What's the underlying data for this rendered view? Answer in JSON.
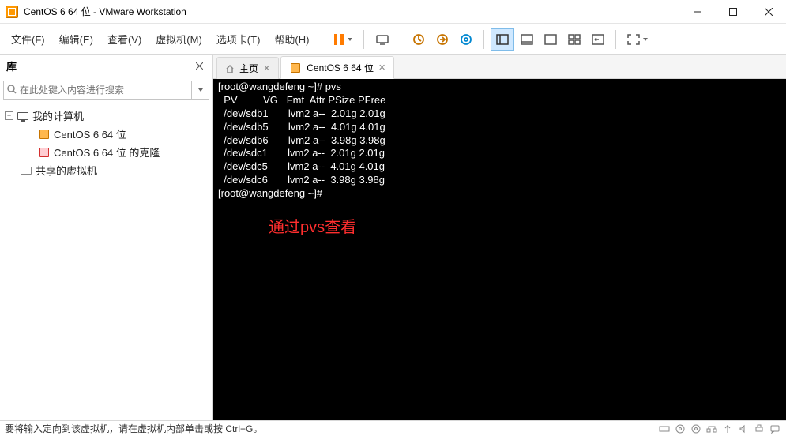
{
  "title": "CentOS 6 64 位 - VMware Workstation",
  "menu": {
    "file": "文件(F)",
    "edit": "编辑(E)",
    "view": "查看(V)",
    "vm": "虚拟机(M)",
    "tabs": "选项卡(T)",
    "help": "帮助(H)"
  },
  "sidebar": {
    "title": "库",
    "search_placeholder": "在此处键入内容进行搜索",
    "nodes": {
      "mycomputer": "我的计算机",
      "vm1": "CentOS 6 64 位",
      "vm2": "CentOS 6 64 位 的克隆",
      "shared": "共享的虚拟机"
    }
  },
  "tabs": {
    "home": "主页",
    "vm": "CentOS 6 64 位"
  },
  "terminal": {
    "lines": [
      "[root@wangdefeng ~]# pvs",
      "  PV         VG   Fmt  Attr PSize PFree",
      "  /dev/sdb1       lvm2 a--  2.01g 2.01g",
      "  /dev/sdb5       lvm2 a--  4.01g 4.01g",
      "  /dev/sdb6       lvm2 a--  3.98g 3.98g",
      "  /dev/sdc1       lvm2 a--  2.01g 2.01g",
      "  /dev/sdc5       lvm2 a--  4.01g 4.01g",
      "  /dev/sdc6       lvm2 a--  3.98g 3.98g",
      "[root@wangdefeng ~]# "
    ],
    "annotation": "通过pvs查看"
  },
  "statusbar": "要将输入定向到该虚拟机，请在虚拟机内部单击或按 Ctrl+G。"
}
